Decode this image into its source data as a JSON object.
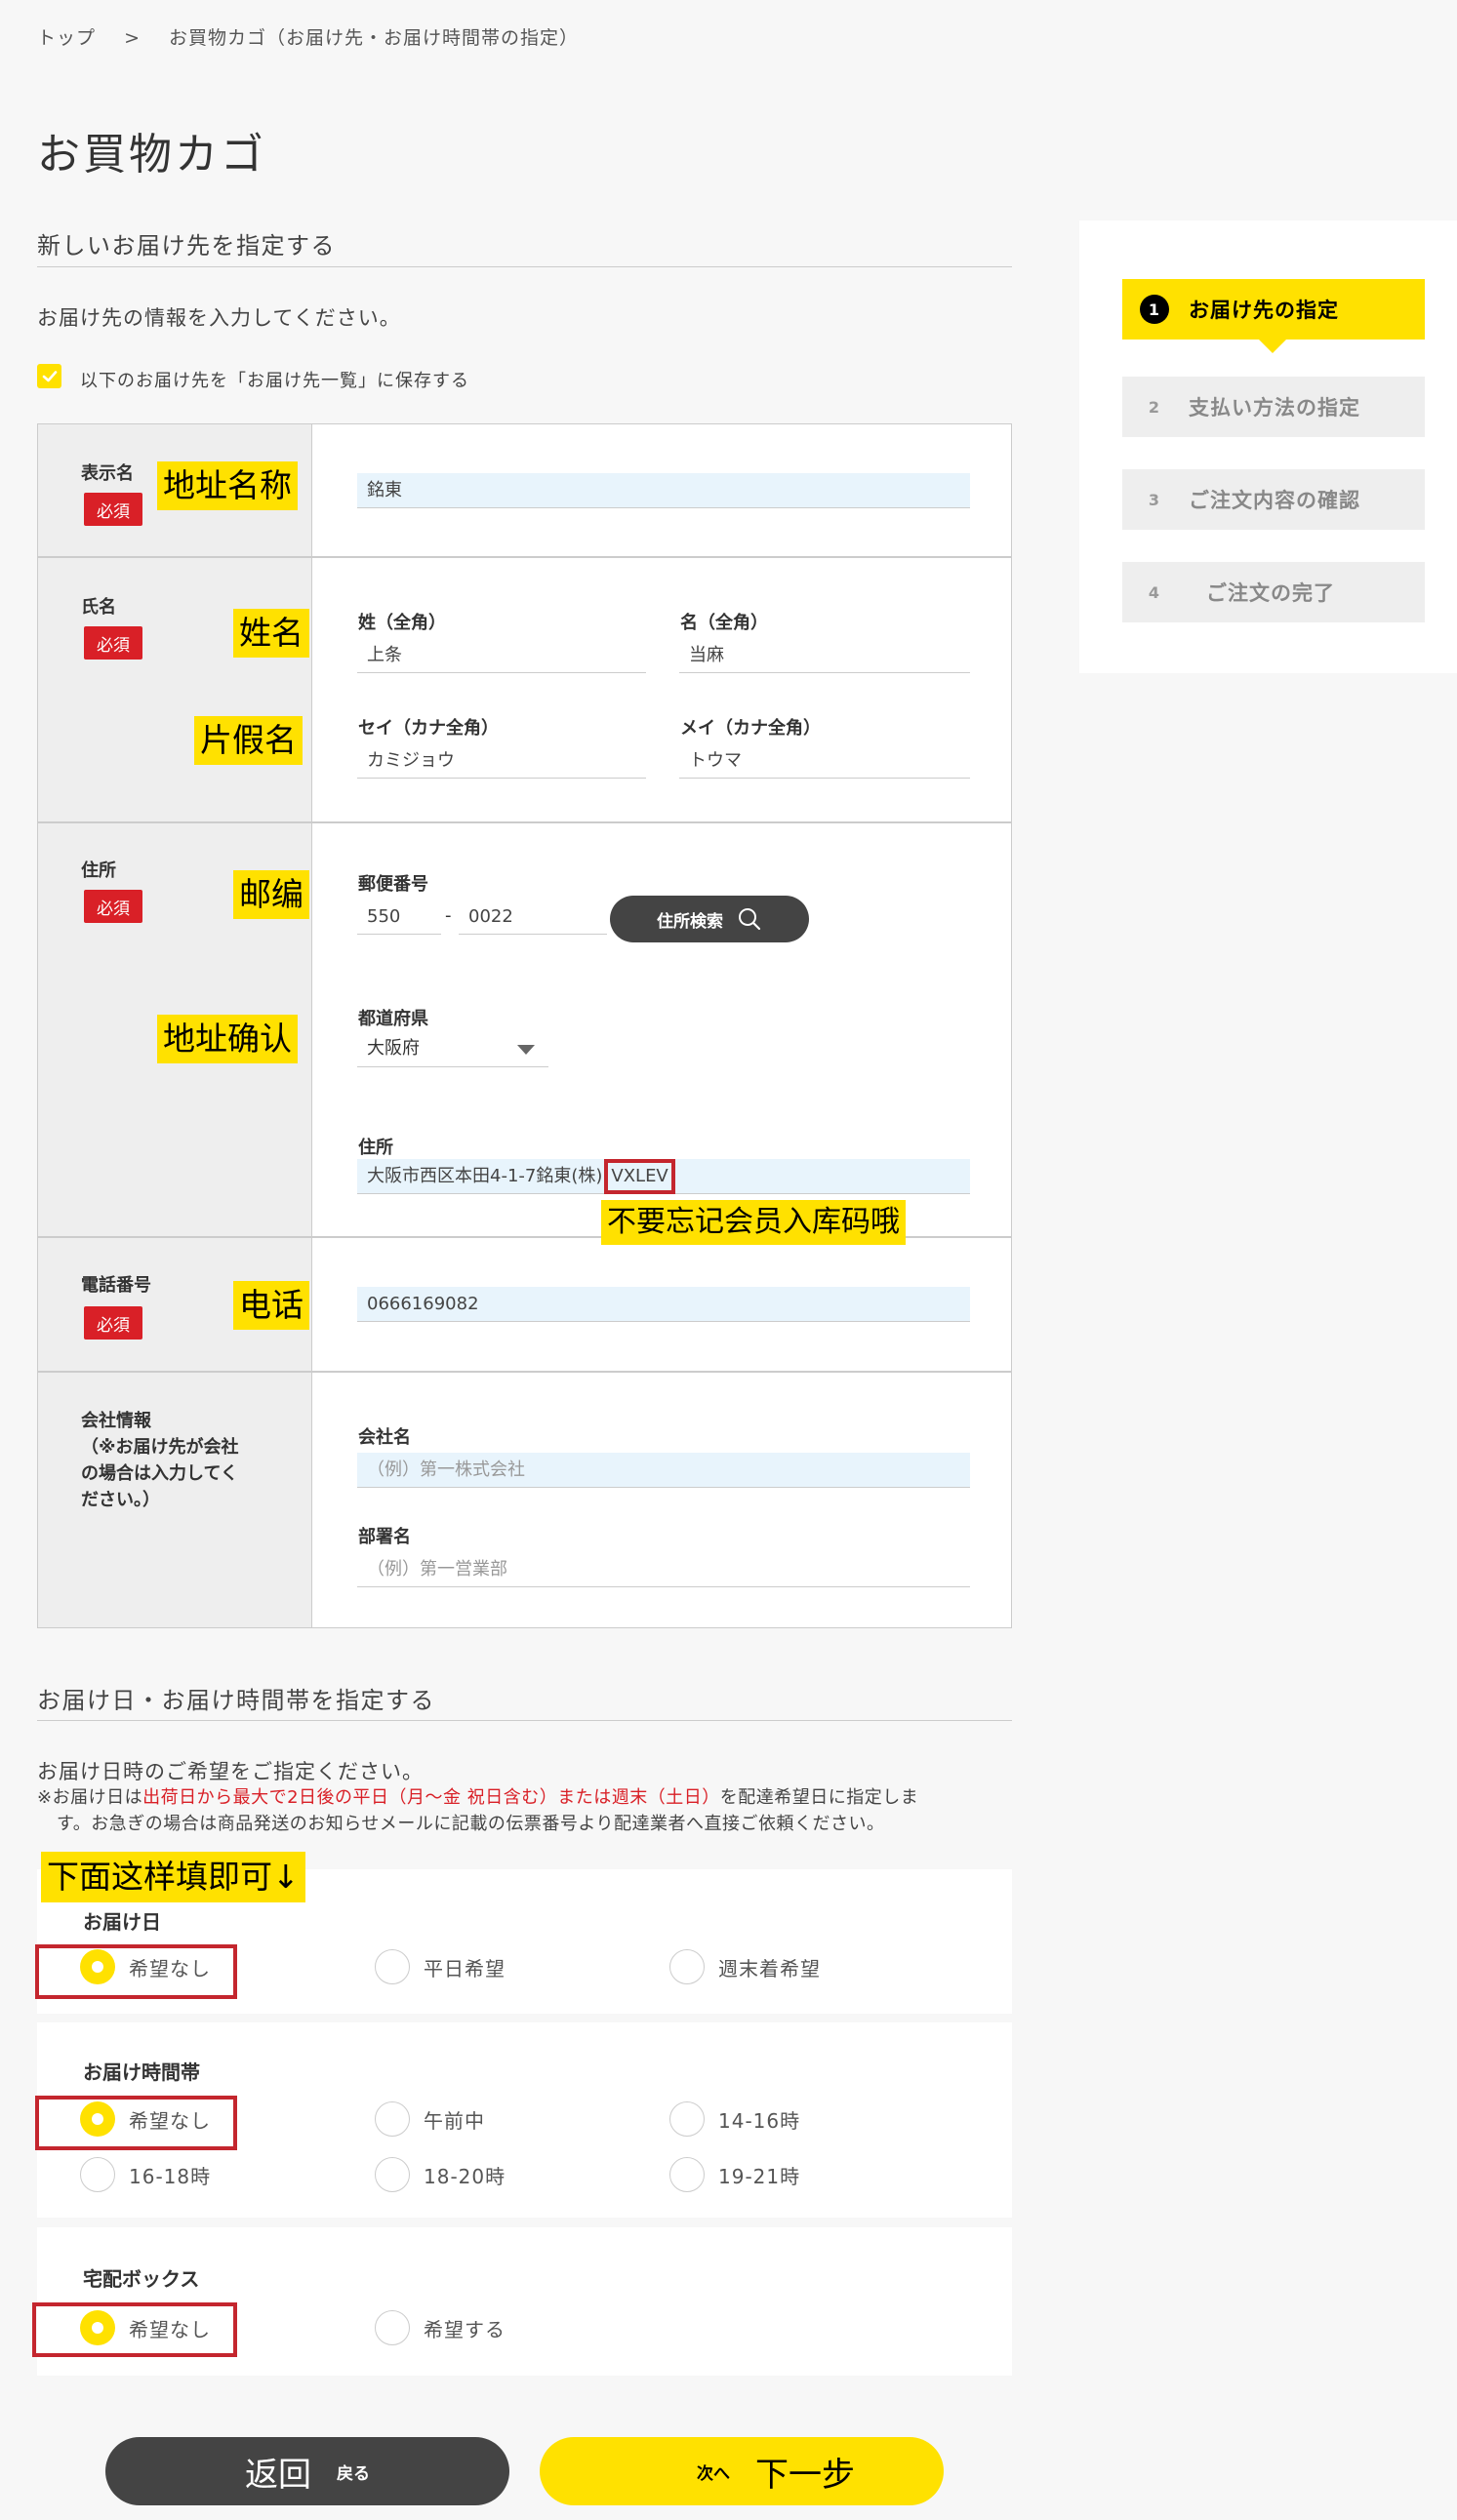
{
  "breadcrumb": {
    "home": "トップ",
    "separator": ">",
    "current": "お買物カゴ（お届け先・お届け時間帯の指定）"
  },
  "page_title": "お買物カゴ",
  "address_section": {
    "heading": "新しいお届け先を指定する",
    "intro": "お届け先の情報を入力してください。",
    "save_checkbox_label": "以下のお届け先を「お届け先一覧」に保存する",
    "required_badge": "必須",
    "display_name": {
      "label": "表示名",
      "value": "銘東",
      "note": "地址名称"
    },
    "name": {
      "label": "氏名",
      "note_name": "姓名",
      "note_kana": "片假名",
      "last_label": "姓（全角）",
      "last_value": "上条",
      "first_label": "名（全角）",
      "first_value": "当麻",
      "last_kana_label": "セイ（カナ全角）",
      "last_kana_value": "カミジョウ",
      "first_kana_label": "メイ（カナ全角）",
      "first_kana_value": "トウマ"
    },
    "address": {
      "label": "住所",
      "note_zip": "邮编",
      "note_confirm": "地址确认",
      "zip_label": "郵便番号",
      "zip1": "550",
      "zip_sep": "-",
      "zip2": "0022",
      "search_button": "住所検索",
      "pref_label": "都道府県",
      "pref_value": "大阪府",
      "addr_label": "住所",
      "addr_value": "大阪市西区本田4-1-7銘東(株)",
      "addr_code": "VXLEV",
      "note_member": "不要忘记会员入库码哦"
    },
    "phone": {
      "label": "電話番号",
      "value": "0666169082",
      "note": "电话"
    },
    "company": {
      "label": "会社情報\n（※お届け先が会社の場合は入力してください。）",
      "label_lines": [
        "会社情報",
        "（※お届け先が会社",
        "の場合は入力してく",
        "ださい。）"
      ],
      "company_label": "会社名",
      "company_placeholder": "（例）第一株式会社",
      "dept_label": "部署名",
      "dept_placeholder": "（例）第一営業部"
    }
  },
  "delivery_section": {
    "heading": "お届け日・お届け時間帯を指定する",
    "intro": "お届け日時のご希望をご指定ください。",
    "note_prefix": "※お届け日は",
    "note_red": "出荷日から最大で2日後の平日（月〜金 祝日含む）または週末（土日）",
    "note_suffix": "を配達希望日に指定しま",
    "note_line2": "す。お急ぎの場合は商品発送のお知らせメールに記載の伝票番号より配達業者へ直接ご依頼ください。",
    "annotation": "下面这样填即可↓",
    "date": {
      "title": "お届け日",
      "options": [
        "希望なし",
        "平日希望",
        "週末着希望"
      ],
      "selected": "希望なし"
    },
    "time": {
      "title": "お届け時間帯",
      "options": [
        "希望なし",
        "午前中",
        "14-16時",
        "16-18時",
        "18-20時",
        "19-21時"
      ],
      "selected": "希望なし"
    },
    "box": {
      "title": "宅配ボックス",
      "options": [
        "希望なし",
        "希望する"
      ],
      "selected": "希望なし"
    }
  },
  "steps": [
    {
      "num": "1",
      "label": "お届け先の指定",
      "active": true
    },
    {
      "num": "2",
      "label": "支払い方法の指定",
      "active": false
    },
    {
      "num": "3",
      "label": "ご注文内容の確認",
      "active": false
    },
    {
      "num": "4",
      "label": "ご注文の完了",
      "active": false
    }
  ],
  "buttons": {
    "back_note": "返回",
    "back_label": "戻る",
    "next_label": "次へ",
    "next_note": "下一步"
  },
  "colors": {
    "accent": "#ffe100",
    "required": "#d92027",
    "dark": "#444444",
    "highlight_frame": "#c4262e"
  }
}
